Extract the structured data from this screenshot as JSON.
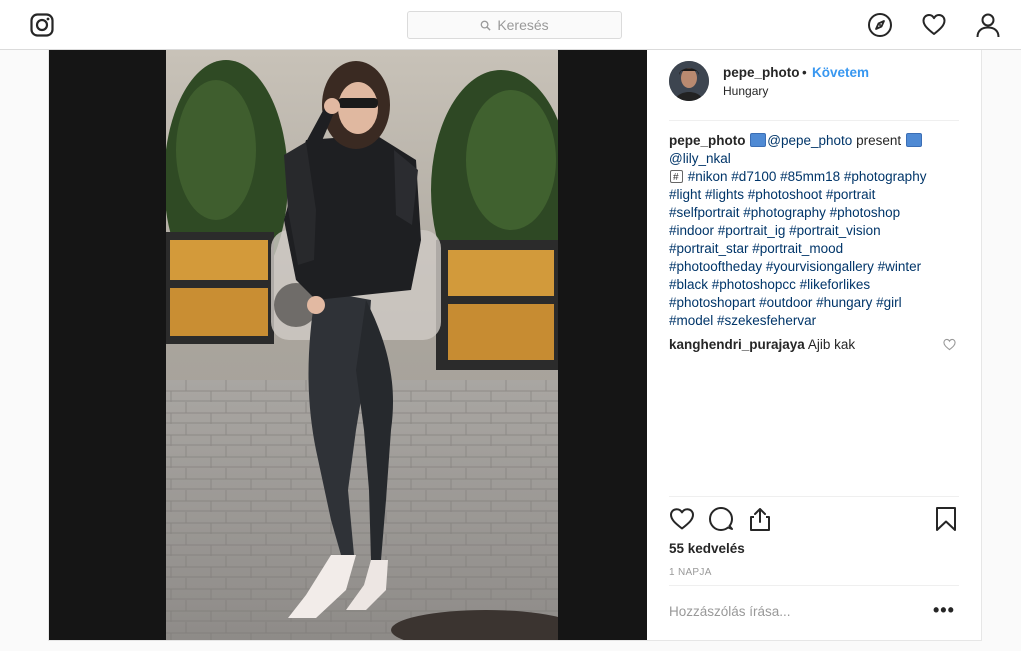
{
  "nav": {
    "logo_icon": "instagram-icon",
    "search_placeholder": "Keresés",
    "icons": [
      "compass-icon",
      "heart-icon",
      "profile-icon"
    ]
  },
  "post": {
    "username": "pepe_photo",
    "separator": "•",
    "follow_label": "Követem",
    "location": "Hungary",
    "caption": {
      "user": "pepe_photo",
      "mention1": "@pepe_photo",
      "text1": "present",
      "mention2": "@lily_nkal",
      "tags_line1": "#nikon #d7100 #85mm18 #photography",
      "tags_line2": "#light #lights #photoshoot #portrait",
      "tags_line3": "#selfportrait #photography #photoshop",
      "tags_line4": "#indoor #portrait_ig #portrait_vision",
      "tags_line5": "#portrait_star #portrait_mood",
      "tags_line6": "#photooftheday #yourvisiongallery #winter",
      "tags_line7": "#black #photoshopcc #likeforlikes",
      "tags_line8": "#photoshopart #outdoor #hungary #girl",
      "tags_line9": "#model #szekesfehervar"
    },
    "comment": {
      "user": "kanghendri_purajaya",
      "text": "Ajib kak"
    },
    "likes": "55 kedvelés",
    "time_ago": "1 napja",
    "add_comment_placeholder": "Hozzászólás írása...",
    "more_label": "•••"
  }
}
